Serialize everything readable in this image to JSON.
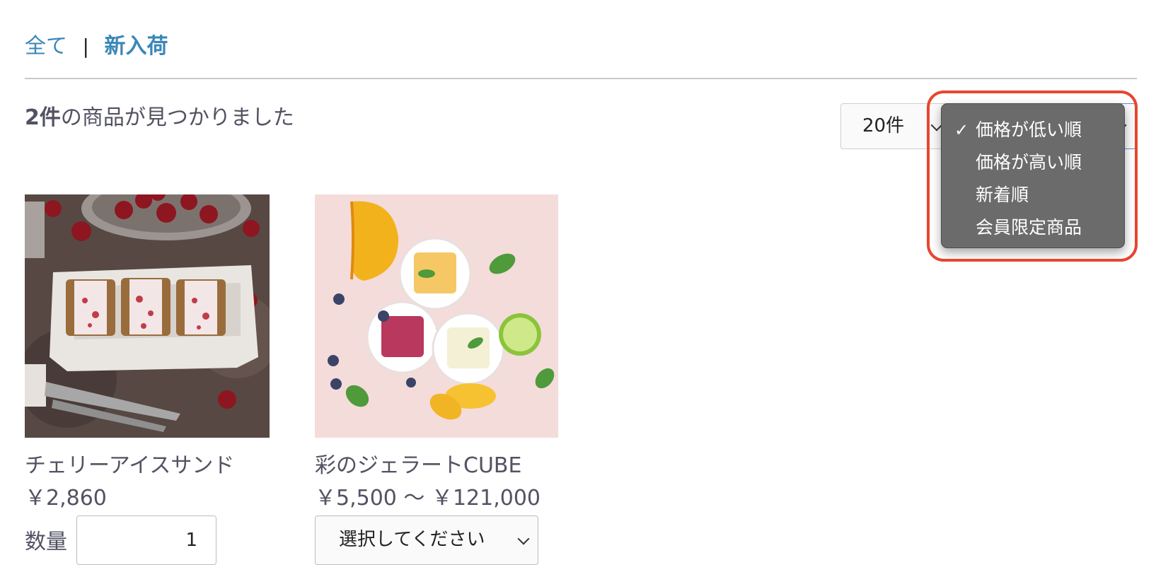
{
  "breadcrumb": {
    "all": "全て",
    "separator": "|",
    "current": "新入荷"
  },
  "results": {
    "count": "2件",
    "suffix": "の商品が見つかりました"
  },
  "display_select": {
    "value": "20件"
  },
  "sort_dropdown": {
    "selected_index": 0,
    "check": "✓",
    "options": [
      "価格が低い順",
      "価格が高い順",
      "新着順",
      "会員限定商品"
    ]
  },
  "products": [
    {
      "name": "チェリーアイスサンド",
      "price": "￥2,860",
      "qty_label": "数量",
      "qty_value": "1"
    },
    {
      "name": "彩のジェラートCUBE",
      "price": "￥5,500 ～ ￥121,000",
      "option_placeholder": "選択してください"
    }
  ],
  "colors": {
    "accent_link": "#3a87b8",
    "text": "#525263",
    "highlight": "#e8452f",
    "menu_bg": "#6b6b6b"
  }
}
